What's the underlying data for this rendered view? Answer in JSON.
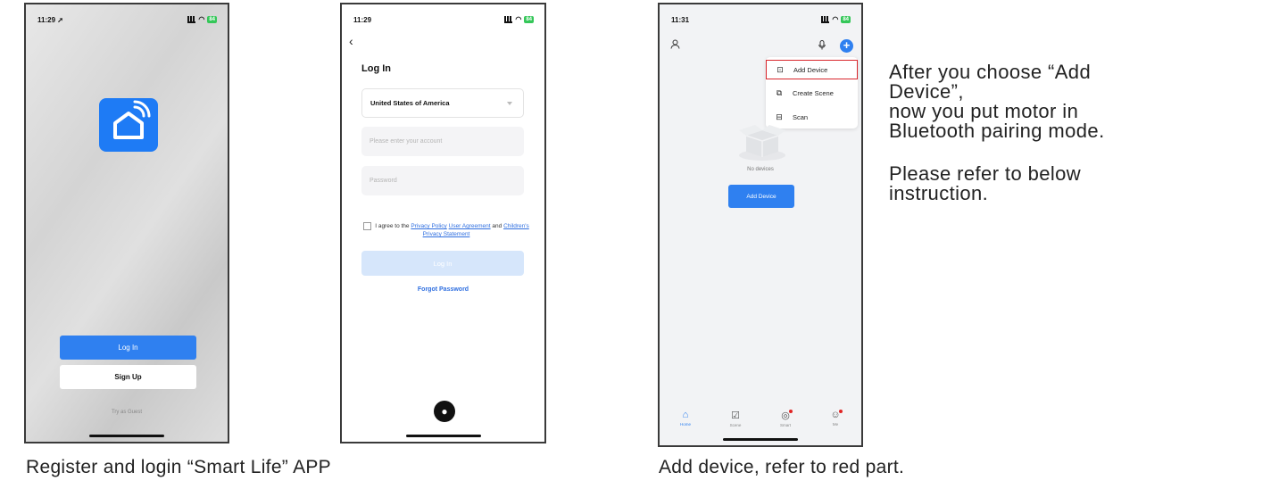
{
  "phone1": {
    "status_time": "11:29 ➚",
    "battery": "84",
    "login_button": "Log In",
    "signup_button": "Sign Up",
    "guest_link": "Try as Guest"
  },
  "phone2": {
    "status_time": "11:29",
    "battery": "84",
    "back_icon": "chevron-left-icon",
    "title": "Log In",
    "country": "United States of America",
    "account_placeholder": "Please enter your account",
    "password_placeholder": "Password",
    "agree_prefix": "I agree to the",
    "privacy_policy": "Privacy Policy",
    "user_agreement": "User Agreement",
    "agree_and": "and",
    "children_statement": "Children's Privacy Statement",
    "login_button": "Log In",
    "forgot_password": "Forgot Password",
    "apple_icon": "apple-icon"
  },
  "phone3": {
    "status_time": "11:31",
    "battery": "84",
    "menu": {
      "items": [
        {
          "label": "Add Device",
          "icon": "add-device-icon",
          "highlighted": true
        },
        {
          "label": "Create Scene",
          "icon": "create-scene-icon",
          "highlighted": false
        },
        {
          "label": "Scan",
          "icon": "scan-icon",
          "highlighted": false
        }
      ]
    },
    "empty_text": "No devices",
    "add_device_button": "Add Device",
    "tabs": [
      {
        "label": "Home",
        "icon": "home-icon",
        "active": true
      },
      {
        "label": "Scene",
        "icon": "scene-icon",
        "active": false
      },
      {
        "label": "Smart",
        "icon": "smart-icon",
        "active": false
      },
      {
        "label": "Me",
        "icon": "me-icon",
        "active": false
      }
    ],
    "highlight_color": "#d9262c",
    "accent_color": "#2f80f0"
  },
  "captions": {
    "left": "Register and login “Smart Life” APP",
    "middle": "Add device, refer to red part.",
    "side_para1_lines": [
      "After you choose “Add",
      "Device”,",
      "now you put motor in",
      "Bluetooth pairing mode."
    ],
    "side_para2_lines": [
      "Please refer to below",
      "instruction."
    ]
  }
}
